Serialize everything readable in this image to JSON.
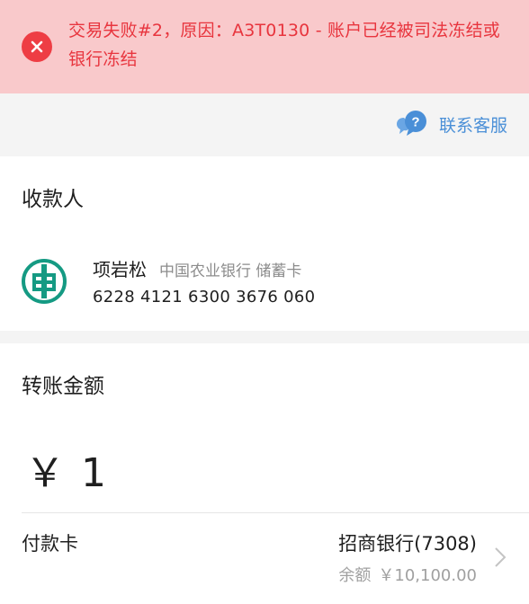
{
  "error_banner": {
    "message": "交易失败#2，原因：A3T0130 - 账户已经被司法冻结或银行冻结",
    "icon": "close-icon",
    "color": "#e8353e",
    "background": "#f9c9cb"
  },
  "service": {
    "label": "联系客服",
    "icon": "chat-question-icon",
    "color": "#4a8fd7"
  },
  "payee": {
    "section_title": "收款人",
    "name": "项岩松",
    "bank": "中国农业银行 储蓄卡",
    "account": "6228 4121 6300 3676 060",
    "logo": "abc-bank-logo",
    "logo_color": "#159a83"
  },
  "transfer": {
    "section_title": "转账金额",
    "currency_symbol": "￥",
    "amount": "1"
  },
  "payer": {
    "label": "付款卡",
    "card_name": "招商银行(7308)",
    "balance_label": "余额",
    "balance_value": "￥10,100.00",
    "chevron_icon": "chevron-right-icon"
  }
}
